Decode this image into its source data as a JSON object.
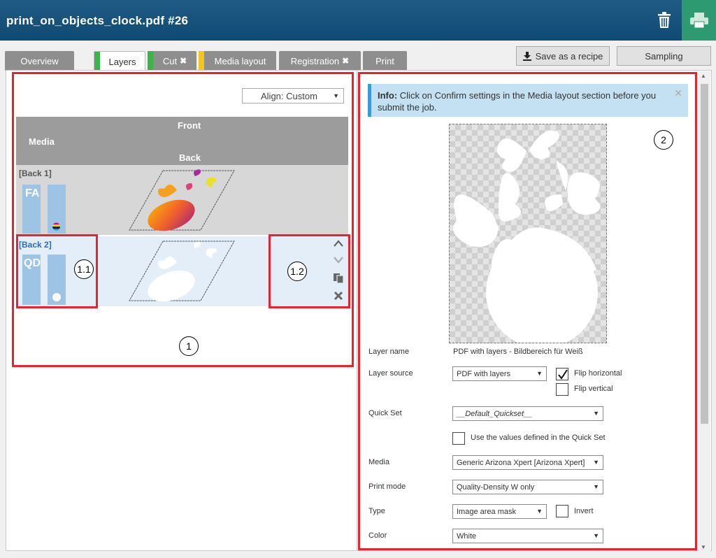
{
  "header": {
    "title": "print_on_objects_clock.pdf #26"
  },
  "tabs": [
    {
      "label": "Overview"
    },
    {
      "label": "Layers"
    },
    {
      "label": "Cut",
      "x": "✖"
    },
    {
      "label": "Media layout"
    },
    {
      "label": "Registration",
      "x": "✖"
    },
    {
      "label": "Print"
    }
  ],
  "buttons": {
    "save_recipe": "Save as a recipe",
    "sampling": "Sampling"
  },
  "colors": {
    "header": "#164f78",
    "print_button": "#2d9a72",
    "tab_layers_stripe": "#3bb54a",
    "tab_media_stripe": "#f5c518",
    "callout_red": "#e8232f",
    "info_border": "#3b9bd6"
  },
  "left": {
    "align": "Align: Custom",
    "head": {
      "front": "Front",
      "media": "Media",
      "back": "Back"
    },
    "rows": [
      {
        "label": "[Back 1]",
        "ink": "FA"
      },
      {
        "label": "[Back 2]",
        "ink": "QD"
      }
    ],
    "callouts": {
      "panel": "1",
      "ink": "1.1",
      "actions": "1.2"
    }
  },
  "right": {
    "info_bold": "Info:",
    "info_text": "Click on Confirm settings in the Media layout section before you submit the job.",
    "callout": "2",
    "form": {
      "layer_name_label": "Layer name",
      "layer_name_value": "PDF with layers - Bildbereich für Weiß",
      "layer_source_label": "Layer source",
      "layer_source_value": "PDF with layers",
      "flip_horizontal": "Flip horizontal",
      "flip_vertical": "Flip vertical",
      "quick_set_label": "Quick Set",
      "quick_set_value": "__Default_Quickset__",
      "use_values": "Use the values defined in the Quick Set",
      "media_label": "Media",
      "media_value": "Generic Arizona Xpert [Arizona Xpert]",
      "print_mode_label": "Print mode",
      "print_mode_value": "Quality-Density W only",
      "type_label": "Type",
      "type_value": "Image area mask",
      "invert": "Invert",
      "color_label": "Color",
      "color_value": "White"
    }
  }
}
